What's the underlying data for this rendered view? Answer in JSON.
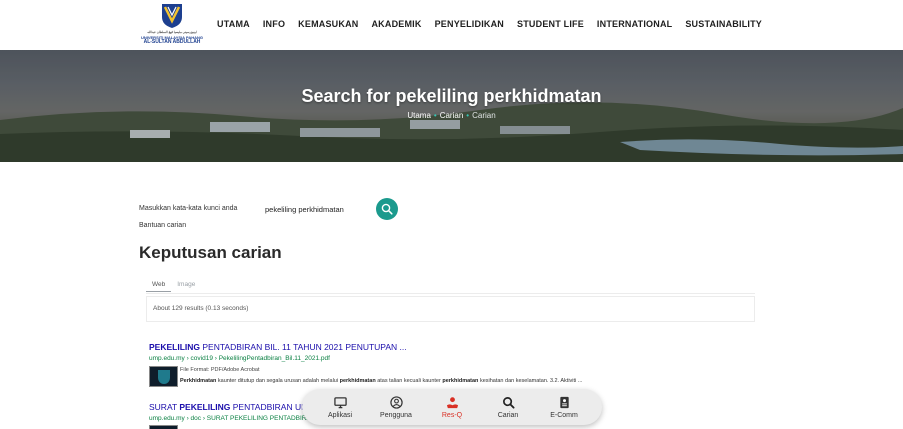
{
  "header": {
    "logo": {
      "line1": "اونيۏرسيتي مليسيا ڤهڠ السلطان عبدالله",
      "line2": "UNIVERSITI MALAYSIA PAHANG",
      "line3": "AL-SULTAN ABDULLAH"
    },
    "nav": [
      "UTAMA",
      "INFO",
      "KEMASUKAN",
      "AKADEMIK",
      "PENYELIDIKAN",
      "STUDENT LIFE",
      "INTERNATIONAL",
      "SUSTAINABILITY"
    ]
  },
  "hero": {
    "title": "Search for pekeliling perkhidmatan",
    "breadcrumb": [
      "Utama",
      "Carian",
      "Carian"
    ]
  },
  "search": {
    "label": "Masukkan kata-kata kunci anda",
    "value": "pekeliling perkhidmatan",
    "help": "Bantuan carian",
    "button_icon": "search-icon"
  },
  "results": {
    "heading": "Keputusan carian",
    "tabs": [
      "Web",
      "Image"
    ],
    "active_tab": "Web",
    "info": "About 129 results (0.13 seconds)",
    "items": [
      {
        "title_bold": "PEKELILING",
        "title_rest": " PENTADBIRAN BIL. 11 TAHUN 2021 PENUTUPAN ...",
        "url": "ump.edu.my › covid19 › PekelilingPentadbiran_Bil.11_2021.pdf",
        "file_format": "File Format: PDF/Adobe Acrobat",
        "snippet_parts": [
          {
            "b": true,
            "t": "Perkhidmatan"
          },
          {
            "b": false,
            "t": " kaunter ditutup dan segala urusan adalah melalui "
          },
          {
            "b": true,
            "t": "perkhidmatan"
          },
          {
            "b": false,
            "t": " atas talian kecuali kaunter "
          },
          {
            "b": true,
            "t": "perkhidmatan"
          },
          {
            "b": false,
            "t": " kesihatan dan keselamatan. 3.2. Aktiviti ..."
          }
        ]
      },
      {
        "title_pre": "SURAT ",
        "title_bold": "PEKELILING",
        "title_rest": " PENTADBIRAN UMP",
        "url": "ump.edu.my › doc › SURAT PEKELILING PENTADBIRAN"
      }
    ]
  },
  "dock": [
    {
      "label": "Aplikasi",
      "icon": "monitor-icon"
    },
    {
      "label": "Pengguna",
      "icon": "user-icon"
    },
    {
      "label": "Res-Q",
      "icon": "res-q-icon"
    },
    {
      "label": "Carian",
      "icon": "search-icon"
    },
    {
      "label": "E-Comm",
      "icon": "document-icon"
    }
  ],
  "colors": {
    "accent": "#1b9a8d",
    "link": "#1a0dab",
    "url": "#0b8043",
    "highlight": "#d93025"
  }
}
